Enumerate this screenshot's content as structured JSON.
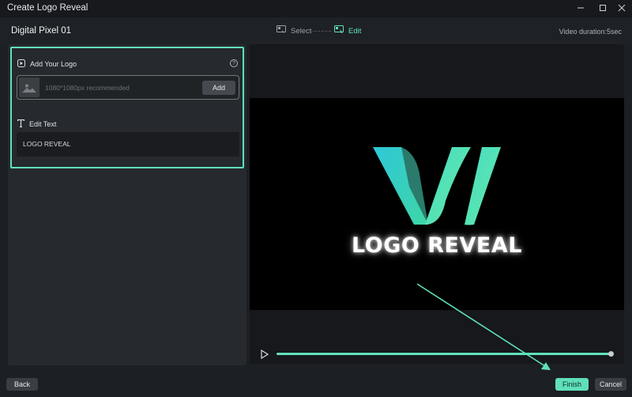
{
  "window": {
    "title": "Create Logo Reveal",
    "minimize_icon": "minimize-icon",
    "maximize_icon": "maximize-icon",
    "close_icon": "close-icon"
  },
  "header": {
    "template_name": "Digital Pixel 01",
    "steps": [
      {
        "label": "Select",
        "icon": "select-step-icon",
        "active": false
      },
      {
        "label": "Edit",
        "icon": "edit-step-icon",
        "active": true
      }
    ],
    "duration": "Video duration:5sec"
  },
  "editor": {
    "logo_section": {
      "label": "Add Your Logo",
      "icon": "logo-section-icon",
      "help_icon": "help-icon",
      "placeholder": "1080*1080px recommended",
      "add_label": "Add"
    },
    "text_section": {
      "label": "Edit Text",
      "icon": "text-icon",
      "value": "LOGO REVEAL"
    }
  },
  "preview": {
    "logo_text": "LOGO REVEAL",
    "progress": 1.0
  },
  "footer": {
    "back_label": "Back",
    "finish_label": "Finish",
    "cancel_label": "Cancel"
  },
  "colors": {
    "accent": "#5fe0bb",
    "background": "#1c1f23",
    "panel": "#26292e"
  }
}
